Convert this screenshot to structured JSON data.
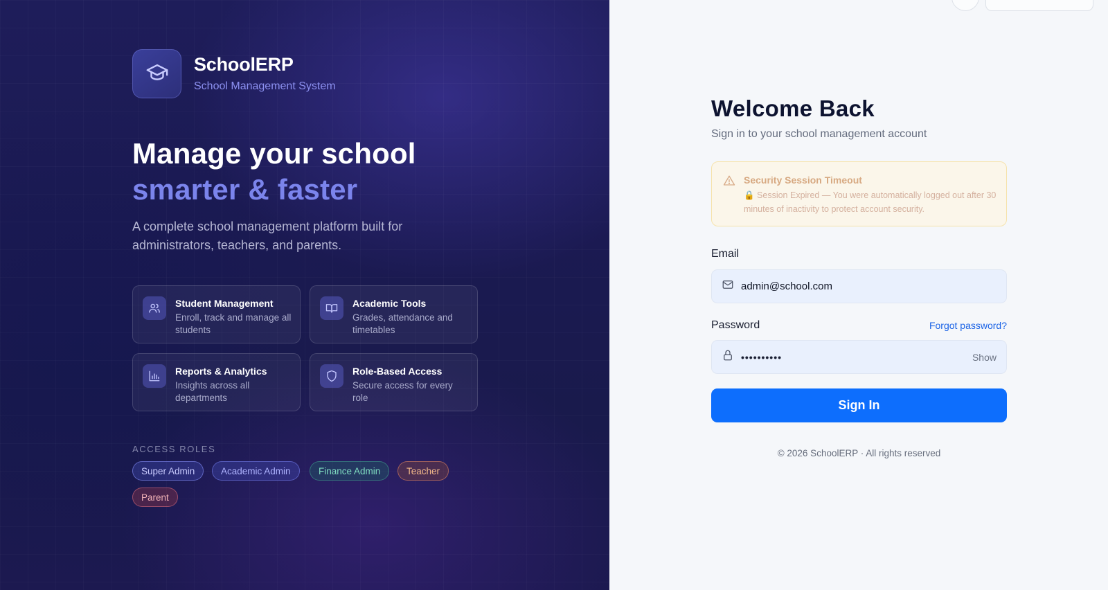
{
  "brand": {
    "name": "SchoolERP",
    "subtitle": "School Management System"
  },
  "hero": {
    "line1": "Manage your school",
    "line2": "smarter & faster",
    "description": "A complete school management platform built for administrators, teachers, and parents."
  },
  "features": [
    {
      "title": "Student Management",
      "description": "Enroll, track and manage all students",
      "icon": "users-icon"
    },
    {
      "title": "Academic Tools",
      "description": "Grades, attendance and timetables",
      "icon": "book-icon"
    },
    {
      "title": "Reports & Analytics",
      "description": "Insights across all departments",
      "icon": "bar-chart-icon"
    },
    {
      "title": "Role-Based Access",
      "description": "Secure access for every role",
      "icon": "shield-icon"
    }
  ],
  "roles": {
    "title": "ACCESS ROLES",
    "items": [
      {
        "label": "Super Admin",
        "color": "#c9cbff"
      },
      {
        "label": "Academic Admin",
        "color": "#aeb3ff"
      },
      {
        "label": "Finance Admin",
        "color": "#7fdcc0"
      },
      {
        "label": "Teacher",
        "color": "#f3b98a"
      },
      {
        "label": "Parent",
        "color": "#f2b3b8"
      }
    ]
  },
  "login": {
    "title": "Welcome Back",
    "subtitle": "Sign in to your school management account",
    "alert": {
      "title": "Security Session Timeout",
      "message": "🔒 Session Expired — You were automatically logged out after 30 minutes of inactivity to protect account security."
    },
    "email_label": "Email",
    "email_value": "admin@school.com",
    "password_label": "Password",
    "forgot_label": "Forgot password?",
    "password_value": "••••••••••",
    "show_label": "Show",
    "submit_label": "Sign In",
    "footer": "© 2026 SchoolERP · All rights reserved"
  },
  "colors": {
    "accent": "#0d6efd",
    "brand_purple": "#7b84ec",
    "left_bg": "#1c1b54"
  }
}
